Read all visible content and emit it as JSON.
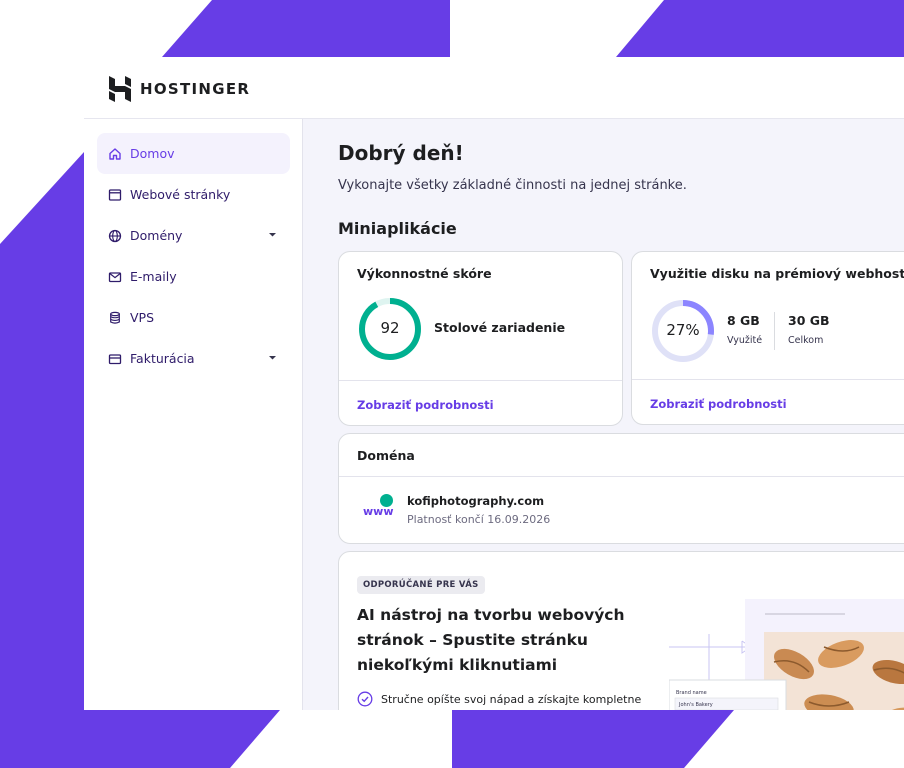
{
  "brand": {
    "name": "HOSTINGER"
  },
  "colors": {
    "accent": "#673de6",
    "success": "#00b090",
    "sidebar_active_bg": "#f4f2fd",
    "main_bg": "#f4f4fb"
  },
  "sidebar": {
    "items": [
      {
        "label": "Domov",
        "icon": "home-icon",
        "active": true
      },
      {
        "label": "Webové stránky",
        "icon": "browser-window-icon"
      },
      {
        "label": "Domény",
        "icon": "globe-icon",
        "expandable": true
      },
      {
        "label": "E-maily",
        "icon": "mail-icon"
      },
      {
        "label": "VPS",
        "icon": "server-icon"
      },
      {
        "label": "Fakturácia",
        "icon": "credit-card-icon",
        "expandable": true
      }
    ]
  },
  "main": {
    "greeting": "Dobrý deň!",
    "subtitle": "Vykonajte všetky základné činnosti na jednej stránke.",
    "section_title": "Miniaplikácie"
  },
  "performance_card": {
    "title": "Výkonnostné skóre",
    "score": "92",
    "score_value": 92,
    "device": "Stolové zariadenie",
    "link": "Zobraziť podrobnosti"
  },
  "disk_card": {
    "title": "Využitie disku na prémiový webhosting",
    "percent_label": "27%",
    "percent_value": 27,
    "used_value": "8 GB",
    "used_caption": "Využité",
    "total_value": "30 GB",
    "total_caption": "Celkom",
    "link": "Zobraziť podrobnosti"
  },
  "domain_card": {
    "title": "Doména",
    "icon_text": "www",
    "domain": "kofiphotography.com",
    "expiry": "Platnosť končí 16.09.2026"
  },
  "recommend_card": {
    "badge": "ODPORÚČANÉ PRE VÁS",
    "title": "AI nástroj na tvorbu webových stránok – Spustite stránku niekoľkými kliknutiami",
    "check_text": "Stručne opíšte svoj nápad a získajte kompletne",
    "preview_field_label": "Brand name",
    "preview_field_value": "John's Bakery"
  }
}
